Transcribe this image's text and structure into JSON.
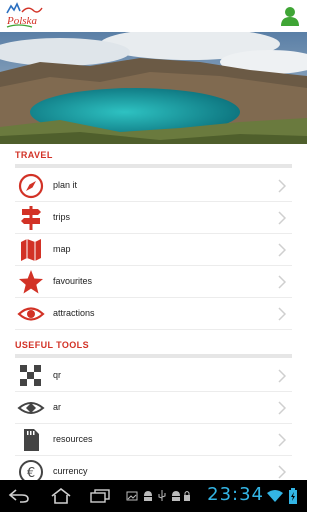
{
  "header": {
    "logo_text": "Polska",
    "user_icon": "user-icon"
  },
  "travel": {
    "title": "TRAVEL",
    "items": [
      {
        "label": "plan it",
        "icon": "compass-icon"
      },
      {
        "label": "trips",
        "icon": "signpost-icon"
      },
      {
        "label": "map",
        "icon": "map-icon"
      },
      {
        "label": "favourites",
        "icon": "star-icon"
      },
      {
        "label": "attractions",
        "icon": "eye-icon"
      }
    ]
  },
  "tools": {
    "title": "USEFUL TOOLS",
    "items": [
      {
        "label": "qr",
        "icon": "qr-icon"
      },
      {
        "label": "ar",
        "icon": "ar-eye-icon"
      },
      {
        "label": "resources",
        "icon": "sd-card-icon"
      },
      {
        "label": "currency",
        "icon": "euro-coin-icon"
      }
    ]
  },
  "system": {
    "time": "23:34"
  },
  "colors": {
    "accent": "#d23226",
    "header_green": "#3fa535",
    "clock_blue": "#33b5e5"
  }
}
